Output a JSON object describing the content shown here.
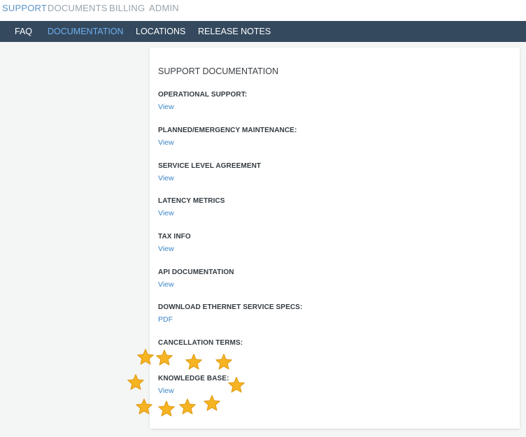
{
  "top_nav": {
    "items": [
      "SUPPORT",
      "DOCUMENTS",
      "BILLING",
      "ADMIN"
    ],
    "active": "SUPPORT"
  },
  "sub_nav": {
    "items": [
      "FAQ",
      "DOCUMENTATION",
      "LOCATIONS",
      "RELEASE NOTES"
    ],
    "active": "DOCUMENTATION"
  },
  "card": {
    "title": "SUPPORT DOCUMENTATION",
    "sections": [
      {
        "heading": "OPERATIONAL SUPPORT:",
        "link": "View"
      },
      {
        "heading": "PLANNED/EMERGENCY MAINTENANCE:",
        "link": "View"
      },
      {
        "heading": "SERVICE LEVEL AGREEMENT",
        "link": "View"
      },
      {
        "heading": "LATENCY METRICS",
        "link": "View"
      },
      {
        "heading": "TAX INFO",
        "link": "View"
      },
      {
        "heading": "API DOCUMENTATION",
        "link": "View"
      },
      {
        "heading": "DOWNLOAD ETHERNET SERVICE SPECS:",
        "link": "PDF"
      },
      {
        "heading": "CANCELLATION TERMS:",
        "link": ""
      },
      {
        "heading": "KNOWLEDGE BASE:",
        "link": "View"
      }
    ]
  },
  "colors": {
    "active_top": "#5f95c6",
    "inactive_top": "#9aa3ad",
    "subnav_bg": "#34495e",
    "active_sub": "#6fb0ef",
    "link": "#3b86c7",
    "star_fill": "#f7b422",
    "star_stroke": "#e09a12"
  },
  "icons": {
    "decoration": "star-icon"
  }
}
